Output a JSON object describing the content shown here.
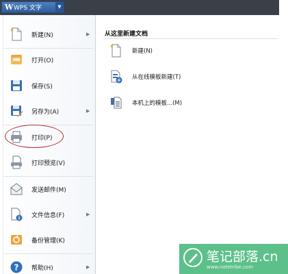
{
  "titlebar": {
    "logo": "W",
    "app_name": "WPS 文字",
    "menu_arrow": "▼"
  },
  "left_menu": {
    "items": [
      {
        "label": "新建(N)",
        "icon": "new-doc-icon",
        "has_arrow": true
      },
      {
        "label": "打开(O)",
        "icon": "folder-open-icon",
        "has_arrow": false
      },
      {
        "label": "保存(S)",
        "icon": "save-icon",
        "has_arrow": false
      },
      {
        "label": "另存为(A)",
        "icon": "save-as-icon",
        "has_arrow": true
      },
      {
        "label": "打印(P)",
        "icon": "print-icon",
        "has_arrow": false
      },
      {
        "label": "打印预览(V)",
        "icon": "print-preview-icon",
        "has_arrow": false
      },
      {
        "label": "发送邮件(M)",
        "icon": "mail-icon",
        "has_arrow": false
      },
      {
        "label": "文件信息(F)",
        "icon": "file-info-icon",
        "has_arrow": true
      },
      {
        "label": "备份管理(K)",
        "icon": "backup-icon",
        "has_arrow": false
      },
      {
        "label": "帮助(H)",
        "icon": "help-icon",
        "has_arrow": true
      }
    ],
    "arrow": "▶"
  },
  "right_pane": {
    "title": "从这里新建文档",
    "items": [
      {
        "label": "新建(N)",
        "icon": "blank-doc-icon"
      },
      {
        "label": "从在线模板新建(T)",
        "icon": "online-template-icon"
      },
      {
        "label": "本机上的模板...(M)",
        "icon": "local-template-icon"
      }
    ]
  },
  "watermark": {
    "text": "笔记部落.cn",
    "subtext": "www.notetribe.com"
  },
  "colors": {
    "titlebar": "#3a4048",
    "app_button": "#3a6cae",
    "highlight_circle": "#b22a2a",
    "watermark_bg": "#5dc08a"
  }
}
